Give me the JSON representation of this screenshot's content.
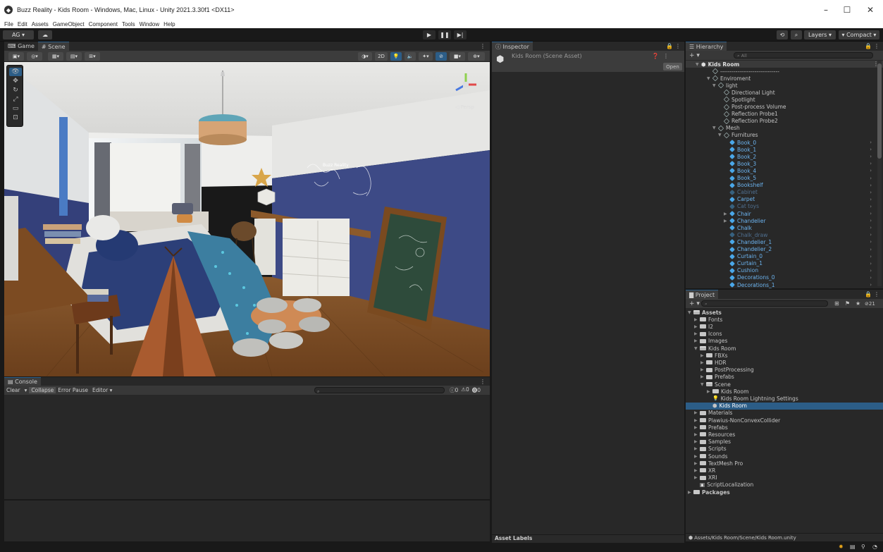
{
  "window": {
    "title": "Buzz Reality - Kids Room - Windows, Mac, Linux - Unity 2021.3.30f1 <DX11>",
    "minimize": "–",
    "maximize": "☐",
    "close": "✕"
  },
  "menu": [
    "File",
    "Edit",
    "Assets",
    "GameObject",
    "Component",
    "Tools",
    "Window",
    "Help"
  ],
  "toolbar": {
    "account": "AG ▾",
    "cloud": "☁",
    "play": "▶",
    "pause": "❚❚",
    "step": "▶|",
    "history": "⟲",
    "search": "⌕",
    "layers": "Layers",
    "layout": "Compact"
  },
  "scene_panel": {
    "tab_game": "Game",
    "tab_scene": "Scene",
    "btn_2d": "2D",
    "wall_text": "Buzz Reality",
    "persp": "◁ Persp"
  },
  "console": {
    "tab": "Console",
    "clear": "Clear",
    "collapse": "Collapse",
    "error_pause": "Error Pause",
    "editor": "Editor ▾",
    "count_info": "0",
    "count_warn": "0",
    "count_error": "0"
  },
  "inspector": {
    "tab": "Inspector",
    "asset_name": "Kids Room (Scene Asset)",
    "open_btn": "Open",
    "asset_labels": "Asset Labels"
  },
  "hierarchy": {
    "tab": "Hierarchy",
    "add": "+ ▾",
    "search_placeholder": "All",
    "scene": "Kids Room",
    "items": [
      {
        "label": "-------------------------------",
        "depth": 1,
        "type": "outline",
        "arrow": ""
      },
      {
        "label": "Enviroment",
        "depth": 1,
        "type": "outline",
        "arrow": "▼"
      },
      {
        "label": "light",
        "depth": 2,
        "type": "outline",
        "arrow": "▼"
      },
      {
        "label": "Directional Light",
        "depth": 3,
        "type": "outline",
        "arrow": ""
      },
      {
        "label": "Spotlight",
        "depth": 3,
        "type": "outline",
        "arrow": ""
      },
      {
        "label": "Post-process Volume",
        "depth": 3,
        "type": "outline",
        "arrow": ""
      },
      {
        "label": "Reflection Probe1",
        "depth": 3,
        "type": "outline",
        "arrow": ""
      },
      {
        "label": "Reflection Probe2",
        "depth": 3,
        "type": "outline",
        "arrow": ""
      },
      {
        "label": "Mesh",
        "depth": 2,
        "type": "outline",
        "arrow": "▼"
      },
      {
        "label": "Furnitures",
        "depth": 3,
        "type": "outline",
        "arrow": "▼"
      },
      {
        "label": "Book_0",
        "depth": 4,
        "type": "blue",
        "arrow": "",
        "chev": true
      },
      {
        "label": "Book_1",
        "depth": 4,
        "type": "blue",
        "arrow": "",
        "chev": true
      },
      {
        "label": "Book_2",
        "depth": 4,
        "type": "blue",
        "arrow": "",
        "chev": true
      },
      {
        "label": "Book_3",
        "depth": 4,
        "type": "blue",
        "arrow": "",
        "chev": true
      },
      {
        "label": "Book_4",
        "depth": 4,
        "type": "blue",
        "arrow": "",
        "chev": true
      },
      {
        "label": "Book_5",
        "depth": 4,
        "type": "blue",
        "arrow": "",
        "chev": true
      },
      {
        "label": "Bookshelf",
        "depth": 4,
        "type": "blue",
        "arrow": "",
        "chev": true
      },
      {
        "label": "Cabinet",
        "depth": 4,
        "type": "blue-dim",
        "arrow": "",
        "chev": true
      },
      {
        "label": "Carpet",
        "depth": 4,
        "type": "blue",
        "arrow": "",
        "chev": true
      },
      {
        "label": "Cat toys",
        "depth": 4,
        "type": "blue-dim",
        "arrow": "",
        "chev": true
      },
      {
        "label": "Chair",
        "depth": 4,
        "type": "blue",
        "arrow": "▶",
        "chev": true
      },
      {
        "label": "Chandelier",
        "depth": 4,
        "type": "blue",
        "arrow": "▶",
        "chev": true
      },
      {
        "label": "Chalk",
        "depth": 4,
        "type": "blue",
        "arrow": "",
        "chev": true
      },
      {
        "label": "Chalk_draw",
        "depth": 4,
        "type": "blue-dim",
        "arrow": "",
        "chev": true
      },
      {
        "label": "Chandelier_1",
        "depth": 4,
        "type": "blue",
        "arrow": "",
        "chev": true
      },
      {
        "label": "Chandelier_2",
        "depth": 4,
        "type": "blue",
        "arrow": "",
        "chev": true
      },
      {
        "label": "Curtain_0",
        "depth": 4,
        "type": "blue",
        "arrow": "",
        "chev": true
      },
      {
        "label": "Curtain_1",
        "depth": 4,
        "type": "blue",
        "arrow": "",
        "chev": true
      },
      {
        "label": "Cushion",
        "depth": 4,
        "type": "blue",
        "arrow": "",
        "chev": true
      },
      {
        "label": "Decorations_0",
        "depth": 4,
        "type": "blue",
        "arrow": "",
        "chev": true
      },
      {
        "label": "Decorations_1",
        "depth": 4,
        "type": "blue",
        "arrow": "",
        "chev": true
      }
    ]
  },
  "project": {
    "tab": "Project",
    "add": "+ ▾",
    "count": "21",
    "items": [
      {
        "label": "Assets",
        "depth": 0,
        "arrow": "▼",
        "icon": "folder-open",
        "bold": true
      },
      {
        "label": "Fonts",
        "depth": 1,
        "arrow": "▶",
        "icon": "folder"
      },
      {
        "label": "I2",
        "depth": 1,
        "arrow": "▶",
        "icon": "folder"
      },
      {
        "label": "Icons",
        "depth": 1,
        "arrow": "▶",
        "icon": "folder"
      },
      {
        "label": "Images",
        "depth": 1,
        "arrow": "▶",
        "icon": "folder"
      },
      {
        "label": "Kids Room",
        "depth": 1,
        "arrow": "▼",
        "icon": "folder-open"
      },
      {
        "label": "FBXs",
        "depth": 2,
        "arrow": "▶",
        "icon": "folder"
      },
      {
        "label": "HDR",
        "depth": 2,
        "arrow": "▶",
        "icon": "folder"
      },
      {
        "label": "PostProcessing",
        "depth": 2,
        "arrow": "▶",
        "icon": "folder"
      },
      {
        "label": "Prefabs",
        "depth": 2,
        "arrow": "▶",
        "icon": "folder"
      },
      {
        "label": "Scene",
        "depth": 2,
        "arrow": "▼",
        "icon": "folder-open"
      },
      {
        "label": "Kids Room",
        "depth": 3,
        "arrow": "▶",
        "icon": "folder"
      },
      {
        "label": "Kids Room Lightning Settings",
        "depth": 3,
        "arrow": "",
        "icon": "light"
      },
      {
        "label": "Kids Room",
        "depth": 3,
        "arrow": "",
        "icon": "unity",
        "selected": true
      },
      {
        "label": "Materials",
        "depth": 1,
        "arrow": "▶",
        "icon": "folder"
      },
      {
        "label": "Plawius-NonConvexCollider",
        "depth": 1,
        "arrow": "▶",
        "icon": "folder"
      },
      {
        "label": "Prefabs",
        "depth": 1,
        "arrow": "▶",
        "icon": "folder"
      },
      {
        "label": "Resources",
        "depth": 1,
        "arrow": "▶",
        "icon": "folder"
      },
      {
        "label": "Samples",
        "depth": 1,
        "arrow": "▶",
        "icon": "folder"
      },
      {
        "label": "Scripts",
        "depth": 1,
        "arrow": "▶",
        "icon": "folder"
      },
      {
        "label": "Sounds",
        "depth": 1,
        "arrow": "▶",
        "icon": "folder"
      },
      {
        "label": "TextMesh Pro",
        "depth": 1,
        "arrow": "▶",
        "icon": "folder"
      },
      {
        "label": "XR",
        "depth": 1,
        "arrow": "▶",
        "icon": "folder"
      },
      {
        "label": "XRI",
        "depth": 1,
        "arrow": "▶",
        "icon": "folder"
      },
      {
        "label": "ScriptLocalization",
        "depth": 1,
        "arrow": "",
        "icon": "script"
      },
      {
        "label": "Packages",
        "depth": 0,
        "arrow": "▶",
        "icon": "folder",
        "bold": true
      }
    ],
    "path": "Assets/Kids Room/Scene/Kids Room.unity"
  },
  "colors": {
    "accent": "#2c5d87",
    "prefab_blue": "#4aa7e8",
    "panel_bg": "#282828",
    "wall_blue": "#3d4a86"
  }
}
